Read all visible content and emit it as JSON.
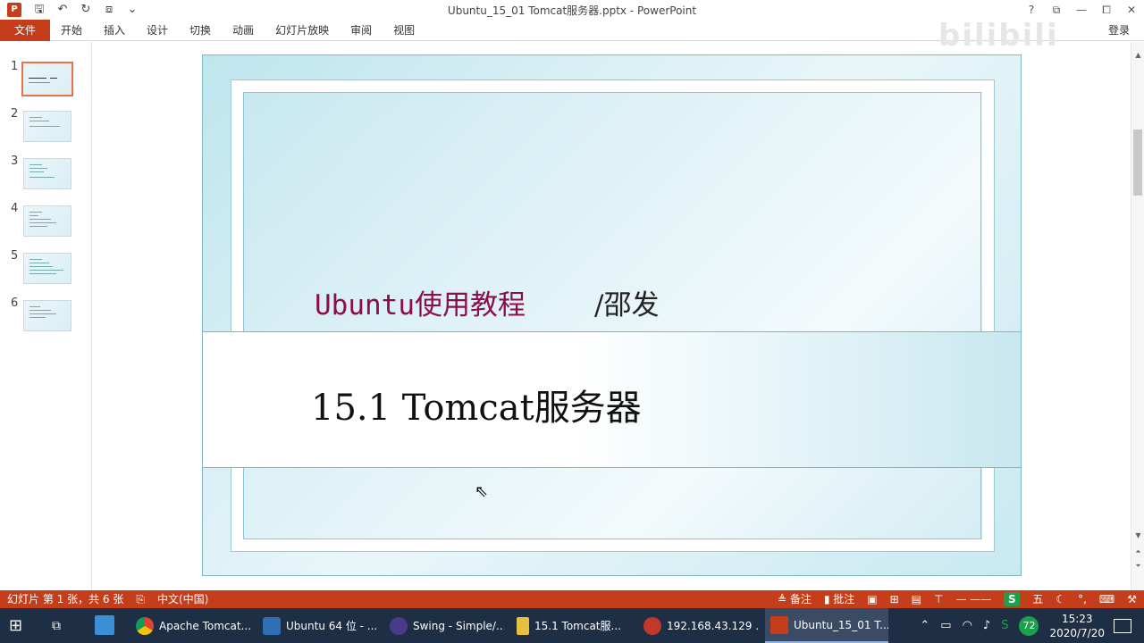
{
  "window": {
    "title": "Ubuntu_15_01 Tomcat服务器.pptx - PowerPoint",
    "app_icon_letter": "P",
    "controls": [
      "?",
      "⧉",
      "—",
      "⧠",
      "✕"
    ]
  },
  "ribbon": {
    "file_tab": "文件",
    "tabs": [
      "开始",
      "插入",
      "设计",
      "切换",
      "动画",
      "幻灯片放映",
      "审阅",
      "视图"
    ],
    "signin": "登录"
  },
  "thumbnails": {
    "slides": [
      {
        "number": "1",
        "active": true
      },
      {
        "number": "2",
        "active": false
      },
      {
        "number": "3",
        "active": false
      },
      {
        "number": "4",
        "active": false
      },
      {
        "number": "5",
        "active": false
      },
      {
        "number": "6",
        "active": false
      }
    ]
  },
  "slide": {
    "subtitle": "Ubuntu使用教程",
    "author": "/邵发",
    "title": "15.1 Tomcat服务器"
  },
  "statusbar": {
    "slide_info": "幻灯片 第 1 张，共 6 张",
    "language": "中文(中国)",
    "notes": "备注",
    "comments": "批注",
    "zoom_badge": "S",
    "ime": "五"
  },
  "taskbar": {
    "items": [
      {
        "label": "Apache Tomcat...",
        "color": "#e0a030"
      },
      {
        "label": "Ubuntu 64 位 - ...",
        "color": "#2f6fb5"
      },
      {
        "label": "Swing - Simple/...",
        "color": "#4a3b8a"
      },
      {
        "label": "15.1 Tomcat服...",
        "color": "#e6c040"
      },
      {
        "label": "192.168.43.129 ...",
        "color": "#c0392b"
      },
      {
        "label": "Ubuntu_15_01 T...",
        "color": "#c43e1c",
        "active": true
      }
    ],
    "tray_badge": "72",
    "time": "15:23",
    "date": "2020/7/20"
  },
  "colors": {
    "accent": "#c43e1c",
    "subtitle": "#8b0d4c",
    "taskbar": "#1e2e45"
  }
}
